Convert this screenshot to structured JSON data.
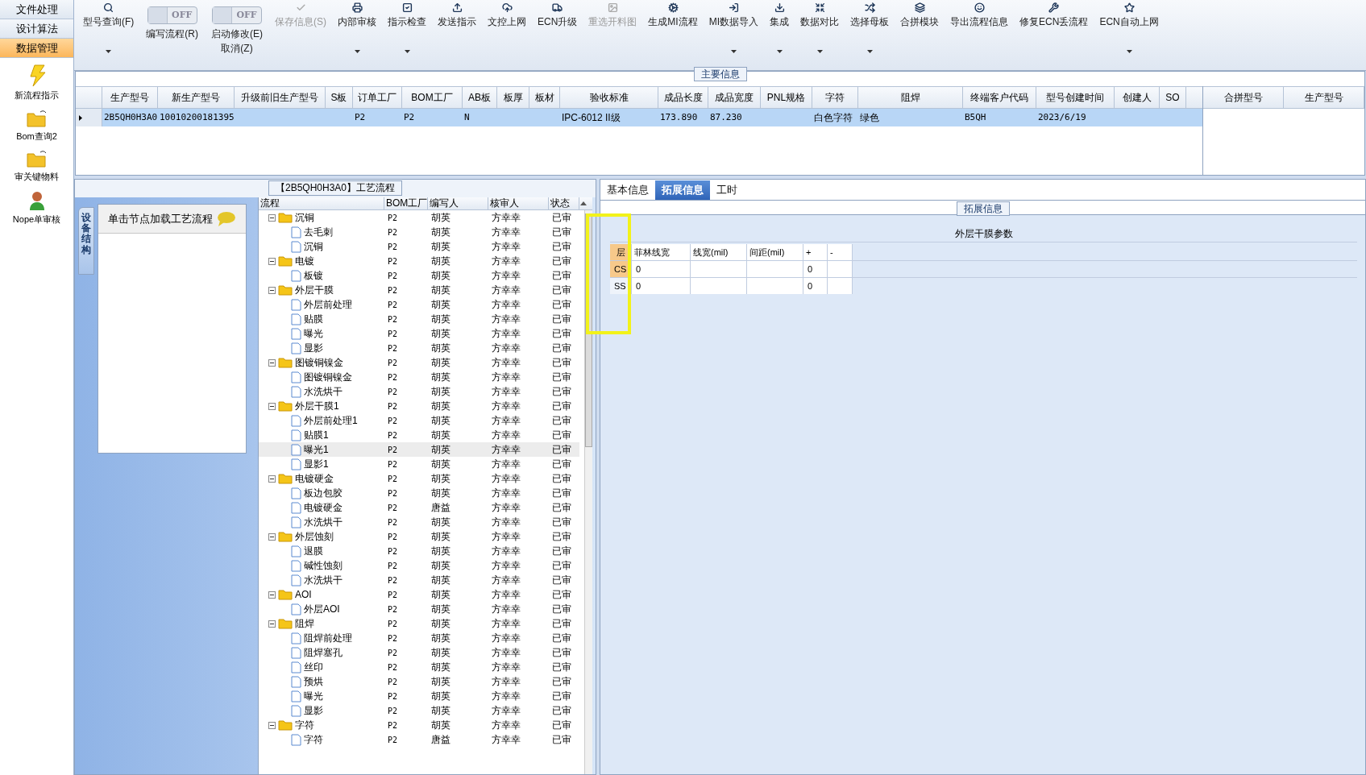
{
  "nav": {
    "tabs": [
      {
        "label": "文件处理",
        "selected": false
      },
      {
        "label": "设计算法",
        "selected": false
      },
      {
        "label": "数据管理",
        "selected": true
      }
    ],
    "items": [
      {
        "label": "新流程指示"
      },
      {
        "label": "Bom查询2"
      },
      {
        "label": "审关键物料"
      },
      {
        "label": "Nope单审核"
      }
    ]
  },
  "toolbar": [
    {
      "kind": "button",
      "label": "型号查询(F)",
      "disabled": false,
      "dropdown": true
    },
    {
      "kind": "toggle",
      "label": "编写流程(R)",
      "on": false,
      "text": "OFF"
    },
    {
      "kind": "toggle",
      "label": "启动修改(E)",
      "label2": "取消(Z)",
      "on": false,
      "text": "OFF"
    },
    {
      "kind": "button",
      "label": "保存信息(S)",
      "disabled": true,
      "dropdown": false
    },
    {
      "kind": "button",
      "label": "内部审核",
      "disabled": false,
      "dropdown": true
    },
    {
      "kind": "button",
      "label": "指示检查",
      "disabled": false,
      "dropdown": true
    },
    {
      "kind": "button",
      "label": "发送指示",
      "disabled": false,
      "dropdown": false
    },
    {
      "kind": "button",
      "label": "文控上网",
      "disabled": false,
      "dropdown": false
    },
    {
      "kind": "button",
      "label": "ECN升级",
      "disabled": false,
      "dropdown": false
    },
    {
      "kind": "button",
      "label": "重选开料图",
      "disabled": true,
      "dropdown": false
    },
    {
      "kind": "button",
      "label": "生成MI流程",
      "disabled": false,
      "dropdown": false
    },
    {
      "kind": "button",
      "label": "MI数据导入",
      "disabled": false,
      "dropdown": true
    },
    {
      "kind": "button",
      "label": "集成",
      "disabled": false,
      "dropdown": true
    },
    {
      "kind": "button",
      "label": "数据对比",
      "disabled": false,
      "dropdown": true
    },
    {
      "kind": "button",
      "label": "选择母板",
      "disabled": false,
      "dropdown": true
    },
    {
      "kind": "button",
      "label": "合拼模块",
      "disabled": false,
      "dropdown": false
    },
    {
      "kind": "button",
      "label": "导出流程信息",
      "disabled": false,
      "dropdown": false
    },
    {
      "kind": "button",
      "label": "修复ECN丢流程",
      "disabled": false,
      "dropdown": false
    },
    {
      "kind": "button",
      "label": "ECN自动上网",
      "disabled": false,
      "dropdown": true
    }
  ],
  "main_info": {
    "title": "主要信息",
    "columns": [
      "生产型号",
      "新生产型号",
      "升级前旧生产型号",
      "S板",
      "订单工厂",
      "BOM工厂",
      "AB板",
      "板厚",
      "板材",
      "验收标准",
      "成品长度",
      "成品宽度",
      "PNL规格",
      "字符",
      "阻焊",
      "终端客户代码",
      "型号创建时间",
      "创建人",
      "SO"
    ],
    "rows": [
      {
        "selected": true,
        "cells": [
          "2B5QH0H3A0",
          "10010200181395",
          "",
          "",
          "P2",
          "P2",
          "N",
          "",
          "",
          "IPC-6012 II级",
          "173.890",
          "87.230",
          "",
          "白色字符",
          "绿色",
          "B5QH",
          "2023/6/19",
          "",
          ""
        ]
      }
    ],
    "side_columns": [
      "合拼型号",
      "生产型号"
    ]
  },
  "process": {
    "title": "【2B5QH0H3A0】工艺流程",
    "side_tab": "设备结构",
    "hint": "单击节点加载工艺流程",
    "columns": [
      "流程",
      "BOM工厂",
      "编写人",
      "核审人",
      "状态"
    ],
    "tree": [
      {
        "name": "沉铜",
        "bom": "P2",
        "writer": "胡英",
        "reviewer": "方幸幸",
        "status": "已审",
        "selected": false,
        "expanded": true,
        "children": [
          {
            "name": "去毛刺",
            "bom": "P2",
            "writer": "胡英",
            "reviewer": "方幸幸",
            "status": "已审",
            "selected": false
          },
          {
            "name": "沉铜",
            "bom": "P2",
            "writer": "胡英",
            "reviewer": "方幸幸",
            "status": "已审",
            "selected": false
          }
        ]
      },
      {
        "name": "电镀",
        "bom": "P2",
        "writer": "胡英",
        "reviewer": "方幸幸",
        "status": "已审",
        "selected": false,
        "expanded": true,
        "children": [
          {
            "name": "板镀",
            "bom": "P2",
            "writer": "胡英",
            "reviewer": "方幸幸",
            "status": "已审",
            "selected": false
          }
        ]
      },
      {
        "name": "外层干膜",
        "bom": "P2",
        "writer": "胡英",
        "reviewer": "方幸幸",
        "status": "已审",
        "selected": false,
        "expanded": true,
        "children": [
          {
            "name": "外层前处理",
            "bom": "P2",
            "writer": "胡英",
            "reviewer": "方幸幸",
            "status": "已审",
            "selected": false
          },
          {
            "name": "贴膜",
            "bom": "P2",
            "writer": "胡英",
            "reviewer": "方幸幸",
            "status": "已审",
            "selected": false
          },
          {
            "name": "曝光",
            "bom": "P2",
            "writer": "胡英",
            "reviewer": "方幸幸",
            "status": "已审",
            "selected": false
          },
          {
            "name": "显影",
            "bom": "P2",
            "writer": "胡英",
            "reviewer": "方幸幸",
            "status": "已审",
            "selected": false
          }
        ]
      },
      {
        "name": "图镀铜镍金",
        "bom": "P2",
        "writer": "胡英",
        "reviewer": "方幸幸",
        "status": "已审",
        "selected": false,
        "expanded": true,
        "children": [
          {
            "name": "图镀铜镍金",
            "bom": "P2",
            "writer": "胡英",
            "reviewer": "方幸幸",
            "status": "已审",
            "selected": false
          },
          {
            "name": "水洗烘干",
            "bom": "P2",
            "writer": "胡英",
            "reviewer": "方幸幸",
            "status": "已审",
            "selected": false
          }
        ]
      },
      {
        "name": "外层干膜1",
        "bom": "P2",
        "writer": "胡英",
        "reviewer": "方幸幸",
        "status": "已审",
        "selected": false,
        "expanded": true,
        "children": [
          {
            "name": "外层前处理1",
            "bom": "P2",
            "writer": "胡英",
            "reviewer": "方幸幸",
            "status": "已审",
            "selected": false
          },
          {
            "name": "贴膜1",
            "bom": "P2",
            "writer": "胡英",
            "reviewer": "方幸幸",
            "status": "已审",
            "selected": false
          },
          {
            "name": "曝光1",
            "bom": "P2",
            "writer": "胡英",
            "reviewer": "方幸幸",
            "status": "已审",
            "selected": true
          },
          {
            "name": "显影1",
            "bom": "P2",
            "writer": "胡英",
            "reviewer": "方幸幸",
            "status": "已审",
            "selected": false
          }
        ]
      },
      {
        "name": "电镀硬金",
        "bom": "P2",
        "writer": "胡英",
        "reviewer": "方幸幸",
        "status": "已审",
        "selected": false,
        "expanded": true,
        "children": [
          {
            "name": "板边包胶",
            "bom": "P2",
            "writer": "胡英",
            "reviewer": "方幸幸",
            "status": "已审",
            "selected": false
          },
          {
            "name": "电镀硬金",
            "bom": "P2",
            "writer": "唐益",
            "reviewer": "方幸幸",
            "status": "已审",
            "selected": false
          },
          {
            "name": "水洗烘干",
            "bom": "P2",
            "writer": "胡英",
            "reviewer": "方幸幸",
            "status": "已审",
            "selected": false
          }
        ]
      },
      {
        "name": "外层蚀刻",
        "bom": "P2",
        "writer": "胡英",
        "reviewer": "方幸幸",
        "status": "已审",
        "selected": false,
        "expanded": true,
        "children": [
          {
            "name": "退膜",
            "bom": "P2",
            "writer": "胡英",
            "reviewer": "方幸幸",
            "status": "已审",
            "selected": false
          },
          {
            "name": "碱性蚀刻",
            "bom": "P2",
            "writer": "胡英",
            "reviewer": "方幸幸",
            "status": "已审",
            "selected": false
          },
          {
            "name": "水洗烘干",
            "bom": "P2",
            "writer": "胡英",
            "reviewer": "方幸幸",
            "status": "已审",
            "selected": false
          }
        ]
      },
      {
        "name": "AOI",
        "bom": "P2",
        "writer": "胡英",
        "reviewer": "方幸幸",
        "status": "已审",
        "selected": false,
        "expanded": true,
        "children": [
          {
            "name": "外层AOI",
            "bom": "P2",
            "writer": "胡英",
            "reviewer": "方幸幸",
            "status": "已审",
            "selected": false
          }
        ]
      },
      {
        "name": "阻焊",
        "bom": "P2",
        "writer": "胡英",
        "reviewer": "方幸幸",
        "status": "已审",
        "selected": false,
        "expanded": true,
        "children": [
          {
            "name": "阻焊前处理",
            "bom": "P2",
            "writer": "胡英",
            "reviewer": "方幸幸",
            "status": "已审",
            "selected": false
          },
          {
            "name": "阻焊塞孔",
            "bom": "P2",
            "writer": "胡英",
            "reviewer": "方幸幸",
            "status": "已审",
            "selected": false
          },
          {
            "name": "丝印",
            "bom": "P2",
            "writer": "胡英",
            "reviewer": "方幸幸",
            "status": "已审",
            "selected": false
          },
          {
            "name": "预烘",
            "bom": "P2",
            "writer": "胡英",
            "reviewer": "方幸幸",
            "status": "已审",
            "selected": false
          },
          {
            "name": "曝光",
            "bom": "P2",
            "writer": "胡英",
            "reviewer": "方幸幸",
            "status": "已审",
            "selected": false
          },
          {
            "name": "显影",
            "bom": "P2",
            "writer": "胡英",
            "reviewer": "方幸幸",
            "status": "已审",
            "selected": false
          }
        ]
      },
      {
        "name": "字符",
        "bom": "P2",
        "writer": "胡英",
        "reviewer": "方幸幸",
        "status": "已审",
        "selected": false,
        "expanded": true,
        "children": [
          {
            "name": "字符",
            "bom": "P2",
            "writer": "唐益",
            "reviewer": "方幸幸",
            "status": "已审",
            "selected": false
          }
        ]
      }
    ]
  },
  "detail": {
    "tabs": [
      {
        "label": "基本信息",
        "selected": false
      },
      {
        "label": "拓展信息",
        "selected": true
      },
      {
        "label": "工时",
        "selected": false
      }
    ],
    "group_title": "拓展信息",
    "grid_title": "外层干膜参数",
    "columns": [
      "层",
      "菲林线宽",
      "线宽(mil)",
      "间距(mil)",
      "+",
      "-"
    ],
    "rows": [
      {
        "cells": [
          "CS",
          "0",
          "",
          "",
          "0",
          ""
        ]
      },
      {
        "cells": [
          "SS",
          "0",
          "",
          "",
          "0",
          ""
        ]
      }
    ]
  }
}
